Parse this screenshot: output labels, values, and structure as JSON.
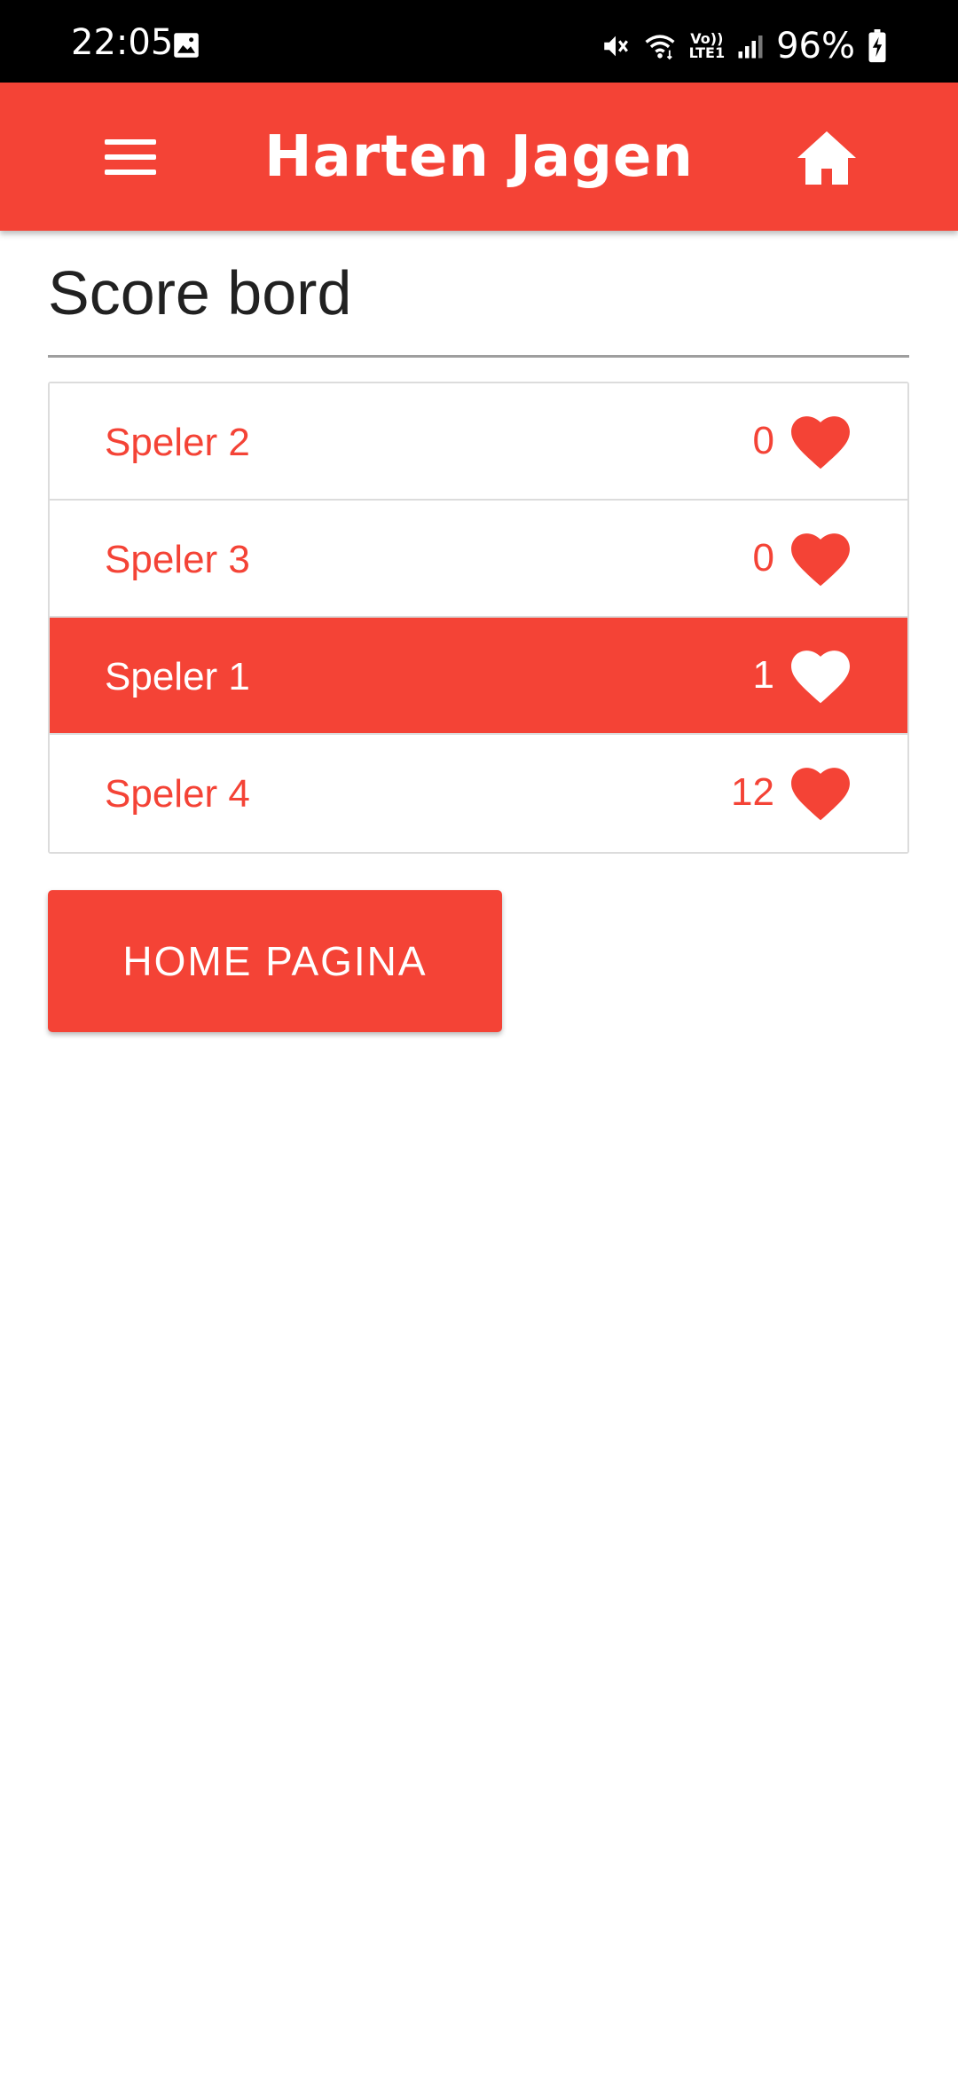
{
  "status_bar": {
    "time": "22:05",
    "battery": "96%",
    "network_label_top": "Vo))",
    "network_label_bottom": "LTE1",
    "icons": [
      "gallery-icon",
      "mute-vibrate-icon",
      "wifi-icon",
      "volte-icon",
      "signal-icon",
      "battery-charging-icon"
    ]
  },
  "app_bar": {
    "title": "Harten Jagen",
    "menu_icon": "menu-icon",
    "home_icon": "home-icon",
    "color": "#f44336"
  },
  "page": {
    "title": "Score bord"
  },
  "scoreboard": {
    "rows": [
      {
        "name": "Speler 2",
        "score": "0",
        "active": false
      },
      {
        "name": "Speler 3",
        "score": "0",
        "active": false
      },
      {
        "name": "Speler 1",
        "score": "1",
        "active": true
      },
      {
        "name": "Speler 4",
        "score": "12",
        "active": false
      }
    ],
    "icon": "heart-icon"
  },
  "actions": {
    "home_button_label": "HOME PAGINA"
  },
  "colors": {
    "accent": "#f44336",
    "text_dark": "#212121",
    "background": "#ffffff"
  }
}
